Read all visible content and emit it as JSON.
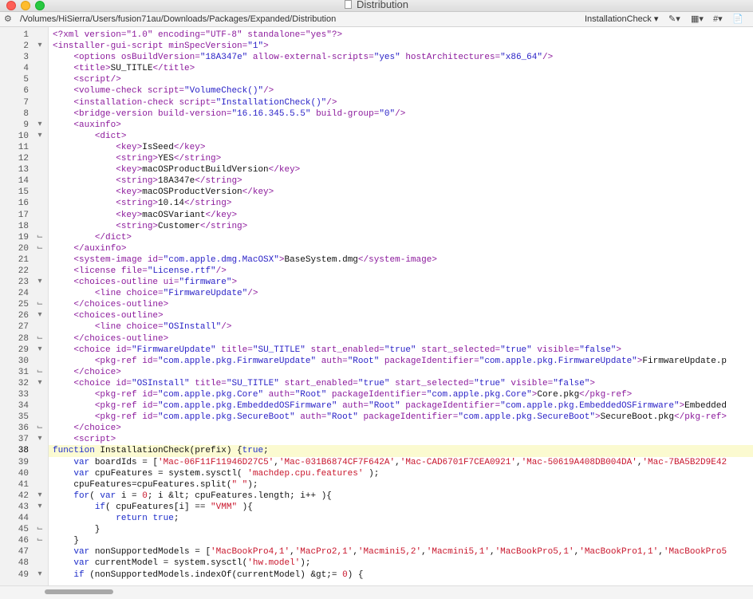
{
  "window": {
    "title": "Distribution",
    "path": "/Volumes/HiSierra/Users/fusion71au/Downloads/Packages/Expanded/Distribution",
    "function_menu": "InstallationCheck",
    "toolbar": {
      "marker": "▾",
      "counter": "▾",
      "hash": "#▾"
    }
  },
  "lines": [
    {
      "n": "1",
      "f": "",
      "segs": [
        [
          "pi",
          "<?xml version=\"1.0\" encoding=\"UTF-8\" standalone=\"yes\"?>"
        ]
      ]
    },
    {
      "n": "2",
      "f": "▾",
      "segs": [
        [
          "tg",
          "<installer-gui-script "
        ],
        [
          "at",
          "minSpecVersion="
        ],
        [
          "sv",
          "\"1\""
        ],
        [
          "tg",
          ">"
        ]
      ]
    },
    {
      "n": "3",
      "f": "",
      "segs": [
        [
          "tx",
          "    "
        ],
        [
          "tg",
          "<options "
        ],
        [
          "at",
          "osBuildVersion="
        ],
        [
          "sv",
          "\"18A347e\""
        ],
        [
          "at",
          " allow-external-scripts="
        ],
        [
          "sv",
          "\"yes\""
        ],
        [
          "at",
          " hostArchitectures="
        ],
        [
          "sv",
          "\"x86_64\""
        ],
        [
          "tg",
          "/>"
        ]
      ]
    },
    {
      "n": "4",
      "f": "",
      "segs": [
        [
          "tx",
          "    "
        ],
        [
          "tg",
          "<title>"
        ],
        [
          "tx",
          "SU_TITLE"
        ],
        [
          "tg",
          "</title>"
        ]
      ]
    },
    {
      "n": "5",
      "f": "",
      "segs": [
        [
          "tx",
          "    "
        ],
        [
          "tg",
          "<script/>"
        ]
      ]
    },
    {
      "n": "6",
      "f": "",
      "segs": [
        [
          "tx",
          "    "
        ],
        [
          "tg",
          "<volume-check "
        ],
        [
          "at",
          "script="
        ],
        [
          "sv",
          "\"VolumeCheck()\""
        ],
        [
          "tg",
          "/>"
        ]
      ]
    },
    {
      "n": "7",
      "f": "",
      "segs": [
        [
          "tx",
          "    "
        ],
        [
          "tg",
          "<installation-check "
        ],
        [
          "at",
          "script="
        ],
        [
          "sv",
          "\"InstallationCheck()\""
        ],
        [
          "tg",
          "/>"
        ]
      ]
    },
    {
      "n": "8",
      "f": "",
      "segs": [
        [
          "tx",
          "    "
        ],
        [
          "tg",
          "<bridge-version "
        ],
        [
          "at",
          "build-version="
        ],
        [
          "sv",
          "\"16.16.345.5.5\""
        ],
        [
          "at",
          " build-group="
        ],
        [
          "sv",
          "\"0\""
        ],
        [
          "tg",
          "/>"
        ]
      ]
    },
    {
      "n": "9",
      "f": "▾",
      "segs": [
        [
          "tx",
          "    "
        ],
        [
          "tg",
          "<auxinfo>"
        ]
      ]
    },
    {
      "n": "10",
      "f": "▾",
      "segs": [
        [
          "tx",
          "        "
        ],
        [
          "tg",
          "<dict>"
        ]
      ]
    },
    {
      "n": "11",
      "f": "",
      "segs": [
        [
          "tx",
          "            "
        ],
        [
          "tg",
          "<key>"
        ],
        [
          "tx",
          "IsSeed"
        ],
        [
          "tg",
          "</key>"
        ]
      ]
    },
    {
      "n": "12",
      "f": "",
      "segs": [
        [
          "tx",
          "            "
        ],
        [
          "tg",
          "<string>"
        ],
        [
          "tx",
          "YES"
        ],
        [
          "tg",
          "</string>"
        ]
      ]
    },
    {
      "n": "13",
      "f": "",
      "segs": [
        [
          "tx",
          "            "
        ],
        [
          "tg",
          "<key>"
        ],
        [
          "tx",
          "macOSProductBuildVersion"
        ],
        [
          "tg",
          "</key>"
        ]
      ]
    },
    {
      "n": "14",
      "f": "",
      "segs": [
        [
          "tx",
          "            "
        ],
        [
          "tg",
          "<string>"
        ],
        [
          "tx",
          "18A347e"
        ],
        [
          "tg",
          "</string>"
        ]
      ]
    },
    {
      "n": "15",
      "f": "",
      "segs": [
        [
          "tx",
          "            "
        ],
        [
          "tg",
          "<key>"
        ],
        [
          "tx",
          "macOSProductVersion"
        ],
        [
          "tg",
          "</key>"
        ]
      ]
    },
    {
      "n": "16",
      "f": "",
      "segs": [
        [
          "tx",
          "            "
        ],
        [
          "tg",
          "<string>"
        ],
        [
          "tx",
          "10.14"
        ],
        [
          "tg",
          "</string>"
        ]
      ]
    },
    {
      "n": "17",
      "f": "",
      "segs": [
        [
          "tx",
          "            "
        ],
        [
          "tg",
          "<key>"
        ],
        [
          "tx",
          "macOSVariant"
        ],
        [
          "tg",
          "</key>"
        ]
      ]
    },
    {
      "n": "18",
      "f": "",
      "segs": [
        [
          "tx",
          "            "
        ],
        [
          "tg",
          "<string>"
        ],
        [
          "tx",
          "Customer"
        ],
        [
          "tg",
          "</string>"
        ]
      ]
    },
    {
      "n": "19",
      "f": "⌙",
      "segs": [
        [
          "tx",
          "        "
        ],
        [
          "tg",
          "</dict>"
        ]
      ]
    },
    {
      "n": "20",
      "f": "⌙",
      "segs": [
        [
          "tx",
          "    "
        ],
        [
          "tg",
          "</auxinfo>"
        ]
      ]
    },
    {
      "n": "21",
      "f": "",
      "segs": [
        [
          "tx",
          "    "
        ],
        [
          "tg",
          "<system-image "
        ],
        [
          "at",
          "id="
        ],
        [
          "sv",
          "\"com.apple.dmg.MacOSX\""
        ],
        [
          "tg",
          ">"
        ],
        [
          "tx",
          "BaseSystem.dmg"
        ],
        [
          "tg",
          "</system-image>"
        ]
      ]
    },
    {
      "n": "22",
      "f": "",
      "segs": [
        [
          "tx",
          "    "
        ],
        [
          "tg",
          "<license "
        ],
        [
          "at",
          "file="
        ],
        [
          "sv",
          "\"License.rtf\""
        ],
        [
          "tg",
          "/>"
        ]
      ]
    },
    {
      "n": "23",
      "f": "▾",
      "segs": [
        [
          "tx",
          "    "
        ],
        [
          "tg",
          "<choices-outline "
        ],
        [
          "at",
          "ui="
        ],
        [
          "sv",
          "\"firmware\""
        ],
        [
          "tg",
          ">"
        ]
      ]
    },
    {
      "n": "24",
      "f": "",
      "segs": [
        [
          "tx",
          "        "
        ],
        [
          "tg",
          "<line "
        ],
        [
          "at",
          "choice="
        ],
        [
          "sv",
          "\"FirmwareUpdate\""
        ],
        [
          "tg",
          "/>"
        ]
      ]
    },
    {
      "n": "25",
      "f": "⌙",
      "segs": [
        [
          "tx",
          "    "
        ],
        [
          "tg",
          "</choices-outline>"
        ]
      ]
    },
    {
      "n": "26",
      "f": "▾",
      "segs": [
        [
          "tx",
          "    "
        ],
        [
          "tg",
          "<choices-outline>"
        ]
      ]
    },
    {
      "n": "27",
      "f": "",
      "segs": [
        [
          "tx",
          "        "
        ],
        [
          "tg",
          "<line "
        ],
        [
          "at",
          "choice="
        ],
        [
          "sv",
          "\"OSInstall\""
        ],
        [
          "tg",
          "/>"
        ]
      ]
    },
    {
      "n": "28",
      "f": "⌙",
      "segs": [
        [
          "tx",
          "    "
        ],
        [
          "tg",
          "</choices-outline>"
        ]
      ]
    },
    {
      "n": "29",
      "f": "▾",
      "segs": [
        [
          "tx",
          "    "
        ],
        [
          "tg",
          "<choice "
        ],
        [
          "at",
          "id="
        ],
        [
          "sv",
          "\"FirmwareUpdate\""
        ],
        [
          "at",
          " title="
        ],
        [
          "sv",
          "\"SU_TITLE\""
        ],
        [
          "at",
          " start_enabled="
        ],
        [
          "sv",
          "\"true\""
        ],
        [
          "at",
          " start_selected="
        ],
        [
          "sv",
          "\"true\""
        ],
        [
          "at",
          " visible="
        ],
        [
          "sv",
          "\"false\""
        ],
        [
          "tg",
          ">"
        ]
      ]
    },
    {
      "n": "30",
      "f": "",
      "segs": [
        [
          "tx",
          "        "
        ],
        [
          "tg",
          "<pkg-ref "
        ],
        [
          "at",
          "id="
        ],
        [
          "sv",
          "\"com.apple.pkg.FirmwareUpdate\""
        ],
        [
          "at",
          " auth="
        ],
        [
          "sv",
          "\"Root\""
        ],
        [
          "at",
          " packageIdentifier="
        ],
        [
          "sv",
          "\"com.apple.pkg.FirmwareUpdate\""
        ],
        [
          "tg",
          ">"
        ],
        [
          "tx",
          "FirmwareUpdate.p"
        ]
      ]
    },
    {
      "n": "31",
      "f": "⌙",
      "segs": [
        [
          "tx",
          "    "
        ],
        [
          "tg",
          "</choice>"
        ]
      ]
    },
    {
      "n": "32",
      "f": "▾",
      "segs": [
        [
          "tx",
          "    "
        ],
        [
          "tg",
          "<choice "
        ],
        [
          "at",
          "id="
        ],
        [
          "sv",
          "\"OSInstall\""
        ],
        [
          "at",
          " title="
        ],
        [
          "sv",
          "\"SU_TITLE\""
        ],
        [
          "at",
          " start_enabled="
        ],
        [
          "sv",
          "\"true\""
        ],
        [
          "at",
          " start_selected="
        ],
        [
          "sv",
          "\"true\""
        ],
        [
          "at",
          " visible="
        ],
        [
          "sv",
          "\"false\""
        ],
        [
          "tg",
          ">"
        ]
      ]
    },
    {
      "n": "33",
      "f": "",
      "segs": [
        [
          "tx",
          "        "
        ],
        [
          "tg",
          "<pkg-ref "
        ],
        [
          "at",
          "id="
        ],
        [
          "sv",
          "\"com.apple.pkg.Core\""
        ],
        [
          "at",
          " auth="
        ],
        [
          "sv",
          "\"Root\""
        ],
        [
          "at",
          " packageIdentifier="
        ],
        [
          "sv",
          "\"com.apple.pkg.Core\""
        ],
        [
          "tg",
          ">"
        ],
        [
          "tx",
          "Core.pkg"
        ],
        [
          "tg",
          "</pkg-ref>"
        ]
      ]
    },
    {
      "n": "34",
      "f": "",
      "segs": [
        [
          "tx",
          "        "
        ],
        [
          "tg",
          "<pkg-ref "
        ],
        [
          "at",
          "id="
        ],
        [
          "sv",
          "\"com.apple.pkg.EmbeddedOSFirmware\""
        ],
        [
          "at",
          " auth="
        ],
        [
          "sv",
          "\"Root\""
        ],
        [
          "at",
          " packageIdentifier="
        ],
        [
          "sv",
          "\"com.apple.pkg.EmbeddedOSFirmware\""
        ],
        [
          "tg",
          ">"
        ],
        [
          "tx",
          "Embedded"
        ]
      ]
    },
    {
      "n": "35",
      "f": "",
      "segs": [
        [
          "tx",
          "        "
        ],
        [
          "tg",
          "<pkg-ref "
        ],
        [
          "at",
          "id="
        ],
        [
          "sv",
          "\"com.apple.pkg.SecureBoot\""
        ],
        [
          "at",
          " auth="
        ],
        [
          "sv",
          "\"Root\""
        ],
        [
          "at",
          " packageIdentifier="
        ],
        [
          "sv",
          "\"com.apple.pkg.SecureBoot\""
        ],
        [
          "tg",
          ">"
        ],
        [
          "tx",
          "SecureBoot.pkg"
        ],
        [
          "tg",
          "</pkg-ref>"
        ]
      ]
    },
    {
      "n": "36",
      "f": "⌙",
      "segs": [
        [
          "tx",
          "    "
        ],
        [
          "tg",
          "</choice>"
        ]
      ]
    },
    {
      "n": "37",
      "f": "▾",
      "segs": [
        [
          "tx",
          "    "
        ],
        [
          "tg",
          "<script>"
        ]
      ]
    },
    {
      "n": "38",
      "f": "",
      "hl": true,
      "segs": [
        [
          "kw",
          "function"
        ],
        [
          "tx",
          " InstallationCheck(prefix) {"
        ],
        [
          "kw",
          "true"
        ],
        [
          "tx",
          ";"
        ]
      ]
    },
    {
      "n": "39",
      "f": "",
      "segs": [
        [
          "tx",
          "    "
        ],
        [
          "kw",
          "var"
        ],
        [
          "tx",
          " boardIds = ["
        ],
        [
          "js",
          "'Mac-06F11F11946D27C5'"
        ],
        [
          "tx",
          ","
        ],
        [
          "js",
          "'Mac-031B6874CF7F642A'"
        ],
        [
          "tx",
          ","
        ],
        [
          "js",
          "'Mac-CAD6701F7CEA0921'"
        ],
        [
          "tx",
          ","
        ],
        [
          "js",
          "'Mac-50619A408DB004DA'"
        ],
        [
          "tx",
          ","
        ],
        [
          "js",
          "'Mac-7BA5B2D9E42"
        ]
      ]
    },
    {
      "n": "40",
      "f": "",
      "segs": [
        [
          "tx",
          "    "
        ],
        [
          "kw",
          "var"
        ],
        [
          "tx",
          " cpuFeatures = system.sysctl( "
        ],
        [
          "js",
          "'machdep.cpu.features'"
        ],
        [
          "tx",
          " );"
        ]
      ]
    },
    {
      "n": "41",
      "f": "",
      "segs": [
        [
          "tx",
          "    cpuFeatures=cpuFeatures.split("
        ],
        [
          "js",
          "\" \""
        ],
        [
          "tx",
          ");"
        ]
      ]
    },
    {
      "n": "42",
      "f": "▾",
      "segs": [
        [
          "tx",
          "    "
        ],
        [
          "kw",
          "for"
        ],
        [
          "tx",
          "( "
        ],
        [
          "kw",
          "var"
        ],
        [
          "tx",
          " i = "
        ],
        [
          "js",
          "0"
        ],
        [
          "tx",
          "; i &lt; cpuFeatures.length; i++ ){"
        ]
      ]
    },
    {
      "n": "43",
      "f": "▾",
      "segs": [
        [
          "tx",
          "        "
        ],
        [
          "kw",
          "if"
        ],
        [
          "tx",
          "( cpuFeatures[i] == "
        ],
        [
          "js",
          "\"VMM\""
        ],
        [
          "tx",
          " ){"
        ]
      ]
    },
    {
      "n": "44",
      "f": "",
      "segs": [
        [
          "tx",
          "            "
        ],
        [
          "kw",
          "return"
        ],
        [
          "tx",
          " "
        ],
        [
          "kw",
          "true"
        ],
        [
          "tx",
          ";"
        ]
      ]
    },
    {
      "n": "45",
      "f": "⌙",
      "segs": [
        [
          "tx",
          "        }"
        ]
      ]
    },
    {
      "n": "46",
      "f": "⌙",
      "segs": [
        [
          "tx",
          "    }"
        ]
      ]
    },
    {
      "n": "47",
      "f": "",
      "segs": [
        [
          "tx",
          "    "
        ],
        [
          "kw",
          "var"
        ],
        [
          "tx",
          " nonSupportedModels = ["
        ],
        [
          "js",
          "'MacBookPro4,1'"
        ],
        [
          "tx",
          ","
        ],
        [
          "js",
          "'MacPro2,1'"
        ],
        [
          "tx",
          ","
        ],
        [
          "js",
          "'Macmini5,2'"
        ],
        [
          "tx",
          ","
        ],
        [
          "js",
          "'Macmini5,1'"
        ],
        [
          "tx",
          ","
        ],
        [
          "js",
          "'MacBookPro5,1'"
        ],
        [
          "tx",
          ","
        ],
        [
          "js",
          "'MacBookPro1,1'"
        ],
        [
          "tx",
          ","
        ],
        [
          "js",
          "'MacBookPro5"
        ]
      ]
    },
    {
      "n": "48",
      "f": "",
      "segs": [
        [
          "tx",
          "    "
        ],
        [
          "kw",
          "var"
        ],
        [
          "tx",
          " currentModel = system.sysctl("
        ],
        [
          "js",
          "'hw.model'"
        ],
        [
          "tx",
          ");"
        ]
      ]
    },
    {
      "n": "49",
      "f": "▾",
      "segs": [
        [
          "tx",
          "    "
        ],
        [
          "kw",
          "if"
        ],
        [
          "tx",
          " (nonSupportedModels.indexOf(currentModel) &gt;= "
        ],
        [
          "js",
          "0"
        ],
        [
          "tx",
          ") {"
        ]
      ]
    }
  ],
  "colors": {
    "tag": "#8c1a9c",
    "xml_string": "#2a22c7",
    "js_keyword": "#1b2bc9",
    "js_string": "#c8152b",
    "current_line": "#fbfad0"
  }
}
